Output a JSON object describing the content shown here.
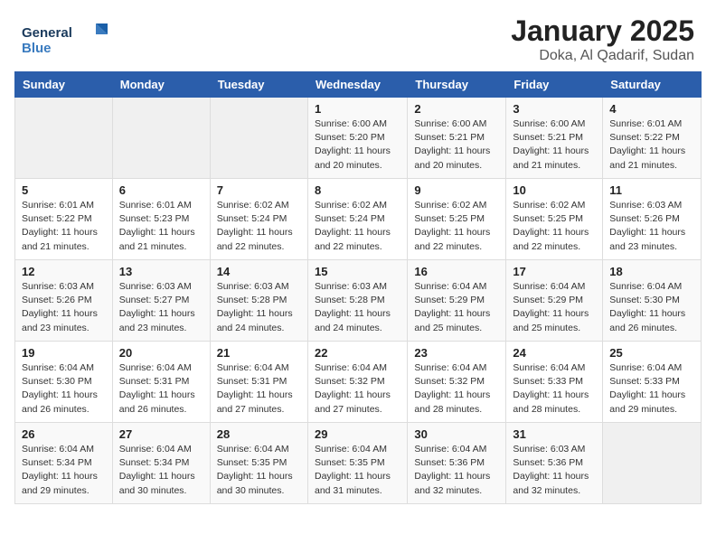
{
  "header": {
    "logo_line1": "General",
    "logo_line2": "Blue",
    "month_title": "January 2025",
    "location": "Doka, Al Qadarif, Sudan"
  },
  "weekdays": [
    "Sunday",
    "Monday",
    "Tuesday",
    "Wednesday",
    "Thursday",
    "Friday",
    "Saturday"
  ],
  "weeks": [
    [
      {
        "day": "",
        "info": ""
      },
      {
        "day": "",
        "info": ""
      },
      {
        "day": "",
        "info": ""
      },
      {
        "day": "1",
        "info": "Sunrise: 6:00 AM\nSunset: 5:20 PM\nDaylight: 11 hours\nand 20 minutes."
      },
      {
        "day": "2",
        "info": "Sunrise: 6:00 AM\nSunset: 5:21 PM\nDaylight: 11 hours\nand 20 minutes."
      },
      {
        "day": "3",
        "info": "Sunrise: 6:00 AM\nSunset: 5:21 PM\nDaylight: 11 hours\nand 21 minutes."
      },
      {
        "day": "4",
        "info": "Sunrise: 6:01 AM\nSunset: 5:22 PM\nDaylight: 11 hours\nand 21 minutes."
      }
    ],
    [
      {
        "day": "5",
        "info": "Sunrise: 6:01 AM\nSunset: 5:22 PM\nDaylight: 11 hours\nand 21 minutes."
      },
      {
        "day": "6",
        "info": "Sunrise: 6:01 AM\nSunset: 5:23 PM\nDaylight: 11 hours\nand 21 minutes."
      },
      {
        "day": "7",
        "info": "Sunrise: 6:02 AM\nSunset: 5:24 PM\nDaylight: 11 hours\nand 22 minutes."
      },
      {
        "day": "8",
        "info": "Sunrise: 6:02 AM\nSunset: 5:24 PM\nDaylight: 11 hours\nand 22 minutes."
      },
      {
        "day": "9",
        "info": "Sunrise: 6:02 AM\nSunset: 5:25 PM\nDaylight: 11 hours\nand 22 minutes."
      },
      {
        "day": "10",
        "info": "Sunrise: 6:02 AM\nSunset: 5:25 PM\nDaylight: 11 hours\nand 22 minutes."
      },
      {
        "day": "11",
        "info": "Sunrise: 6:03 AM\nSunset: 5:26 PM\nDaylight: 11 hours\nand 23 minutes."
      }
    ],
    [
      {
        "day": "12",
        "info": "Sunrise: 6:03 AM\nSunset: 5:26 PM\nDaylight: 11 hours\nand 23 minutes."
      },
      {
        "day": "13",
        "info": "Sunrise: 6:03 AM\nSunset: 5:27 PM\nDaylight: 11 hours\nand 23 minutes."
      },
      {
        "day": "14",
        "info": "Sunrise: 6:03 AM\nSunset: 5:28 PM\nDaylight: 11 hours\nand 24 minutes."
      },
      {
        "day": "15",
        "info": "Sunrise: 6:03 AM\nSunset: 5:28 PM\nDaylight: 11 hours\nand 24 minutes."
      },
      {
        "day": "16",
        "info": "Sunrise: 6:04 AM\nSunset: 5:29 PM\nDaylight: 11 hours\nand 25 minutes."
      },
      {
        "day": "17",
        "info": "Sunrise: 6:04 AM\nSunset: 5:29 PM\nDaylight: 11 hours\nand 25 minutes."
      },
      {
        "day": "18",
        "info": "Sunrise: 6:04 AM\nSunset: 5:30 PM\nDaylight: 11 hours\nand 26 minutes."
      }
    ],
    [
      {
        "day": "19",
        "info": "Sunrise: 6:04 AM\nSunset: 5:30 PM\nDaylight: 11 hours\nand 26 minutes."
      },
      {
        "day": "20",
        "info": "Sunrise: 6:04 AM\nSunset: 5:31 PM\nDaylight: 11 hours\nand 26 minutes."
      },
      {
        "day": "21",
        "info": "Sunrise: 6:04 AM\nSunset: 5:31 PM\nDaylight: 11 hours\nand 27 minutes."
      },
      {
        "day": "22",
        "info": "Sunrise: 6:04 AM\nSunset: 5:32 PM\nDaylight: 11 hours\nand 27 minutes."
      },
      {
        "day": "23",
        "info": "Sunrise: 6:04 AM\nSunset: 5:32 PM\nDaylight: 11 hours\nand 28 minutes."
      },
      {
        "day": "24",
        "info": "Sunrise: 6:04 AM\nSunset: 5:33 PM\nDaylight: 11 hours\nand 28 minutes."
      },
      {
        "day": "25",
        "info": "Sunrise: 6:04 AM\nSunset: 5:33 PM\nDaylight: 11 hours\nand 29 minutes."
      }
    ],
    [
      {
        "day": "26",
        "info": "Sunrise: 6:04 AM\nSunset: 5:34 PM\nDaylight: 11 hours\nand 29 minutes."
      },
      {
        "day": "27",
        "info": "Sunrise: 6:04 AM\nSunset: 5:34 PM\nDaylight: 11 hours\nand 30 minutes."
      },
      {
        "day": "28",
        "info": "Sunrise: 6:04 AM\nSunset: 5:35 PM\nDaylight: 11 hours\nand 30 minutes."
      },
      {
        "day": "29",
        "info": "Sunrise: 6:04 AM\nSunset: 5:35 PM\nDaylight: 11 hours\nand 31 minutes."
      },
      {
        "day": "30",
        "info": "Sunrise: 6:04 AM\nSunset: 5:36 PM\nDaylight: 11 hours\nand 32 minutes."
      },
      {
        "day": "31",
        "info": "Sunrise: 6:03 AM\nSunset: 5:36 PM\nDaylight: 11 hours\nand 32 minutes."
      },
      {
        "day": "",
        "info": ""
      }
    ]
  ]
}
